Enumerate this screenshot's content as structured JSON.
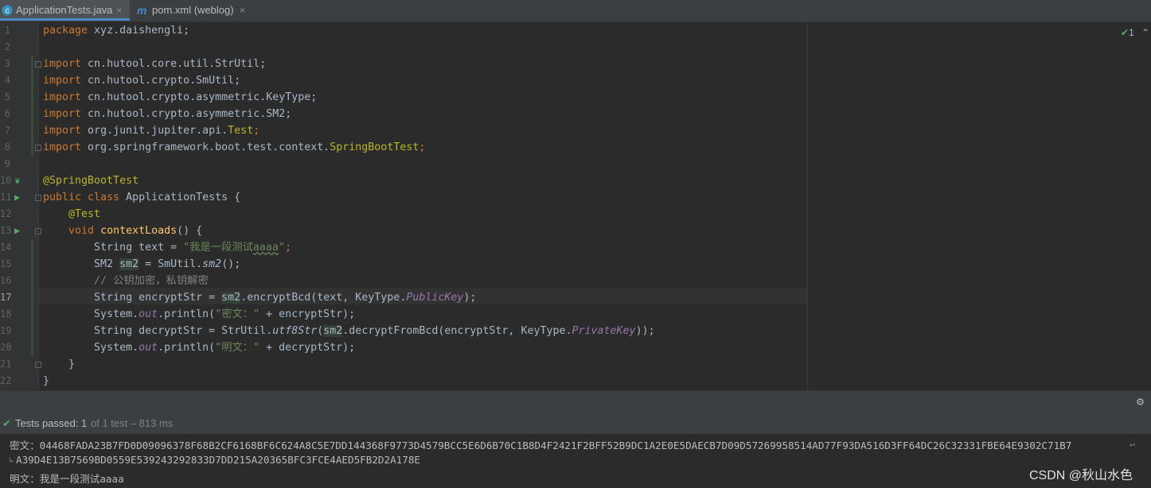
{
  "tabs": [
    {
      "label": "ApplicationTests.java",
      "close": "×",
      "icon": "java-class-icon",
      "active": true
    },
    {
      "label": "pom.xml (weblog)",
      "close": "×",
      "icon": "maven-icon",
      "active": false
    }
  ],
  "inspection": {
    "count": "1"
  },
  "gutter": {
    "line_numbers": [
      "1",
      "2",
      "3",
      "4",
      "5",
      "6",
      "7",
      "8",
      "9",
      "10",
      "11",
      "12",
      "13",
      "14",
      "15",
      "16",
      "17",
      "18",
      "19",
      "20",
      "21",
      "22"
    ]
  },
  "code": {
    "l1": {
      "kw": "package",
      "rest": " xyz.daishengli;"
    },
    "l3": {
      "kw": "import",
      "rest": " cn.hutool.core.util.StrUtil;"
    },
    "l4": {
      "kw": "import",
      "rest": " cn.hutool.crypto.SmUtil;"
    },
    "l5": {
      "kw": "import",
      "rest": " cn.hutool.crypto.asymmetric.KeyType;"
    },
    "l6": {
      "kw": "import",
      "rest": " cn.hutool.crypto.asymmetric.SM2;"
    },
    "l7": {
      "kw": "import",
      "pre": " org.junit.jupiter.api.",
      "cls": "Test",
      "end": ";"
    },
    "l8": {
      "kw": "import",
      "pre": " org.springframework.boot.test.context.",
      "cls": "SpringBootTest",
      "end": ";"
    },
    "l10": {
      "ann": "@SpringBootTest"
    },
    "l11": {
      "kw": "public class",
      "rest": " ApplicationTests {"
    },
    "l12": {
      "ann": "@Test"
    },
    "l13": {
      "kw": "void",
      "fn": "contextLoads",
      "rest": "() {"
    },
    "l14": {
      "pre": "String text = ",
      "str1": "\"我是一段测试",
      "und": "aaaa",
      "str2": "\"",
      "end": ";"
    },
    "l15": {
      "pre": "SM2 ",
      "var": "sm2",
      "mid": " = SmUtil.",
      "method": "sm2",
      "end": "();"
    },
    "l16": {
      "comment": "// 公钥加密，私钥解密"
    },
    "l17": {
      "pre": "String encryptStr = ",
      "var": "sm2",
      "mid": ".encryptBcd(text, KeyType.",
      "const": "PublicKey",
      "end": ");"
    },
    "l18": {
      "pre": "System.",
      "out": "out",
      "mid": ".println(",
      "str": "\"密文：\"",
      "end": " + encryptStr);"
    },
    "l19": {
      "pre": "String decryptStr = StrUtil.",
      "method": "utf8Str",
      "p2": "(",
      "var": "sm2",
      "mid": ".decryptFromBcd(encryptStr, KeyType.",
      "const": "PrivateKey",
      "end": "));"
    },
    "l20": {
      "pre": "System.",
      "out": "out",
      "mid": ".println(",
      "str": "\"明文：\"",
      "end": " + decryptStr);"
    },
    "l21": {
      "text": "}"
    },
    "l22": {
      "text": "}"
    }
  },
  "status": {
    "passed": "Tests passed:",
    "count": "1",
    "rest": "of 1 test – 813 ms"
  },
  "console": {
    "line1": "密文：04468FADA23B7FD0D09096378F68B2CF6168BF6C624A8C5E7DD144368F9773D4579BCC5E6D6B70C1B8D4F2421F2BFF52B9DC1A2E0E5DAECB7D09D57269958514AD77F93DA516D3FF64DC26C32331FBE64E9302C71B7",
    "line2": "A39D4E13B7569BD0559E539243292833D7DD215A20365BFC3FCE4AED5FB2D2A178E",
    "line3": "明文：我是一段测试aaaa"
  },
  "watermark": "CSDN @秋山水色",
  "colors": {
    "accent": "#4a88c7",
    "keyword": "#cc7832",
    "string": "#6a8759",
    "annotation": "#bbb529",
    "pass": "#59a869"
  }
}
